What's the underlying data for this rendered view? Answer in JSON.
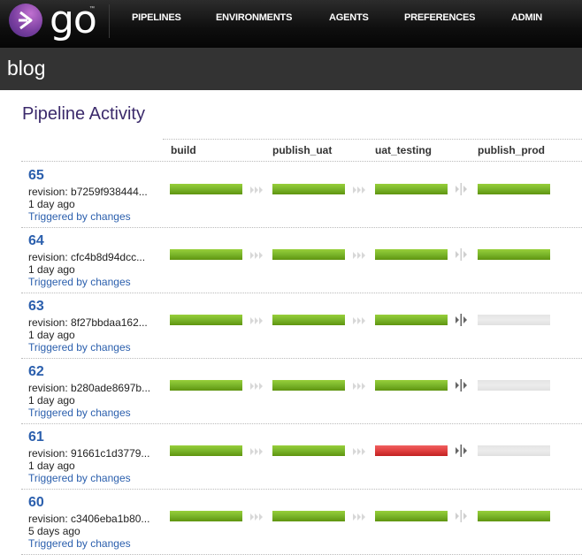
{
  "header": {
    "logo_text": "go",
    "logo_tm": "™",
    "nav": [
      {
        "label": "PIPELINES"
      },
      {
        "label": "ENVIRONMENTS"
      },
      {
        "label": "AGENTS"
      },
      {
        "label": "PREFERENCES"
      },
      {
        "label": "ADMIN"
      }
    ]
  },
  "pipeline_name": "blog",
  "page_title": "Pipeline Activity",
  "stages": [
    "build",
    "publish_uat",
    "uat_testing",
    "publish_prod"
  ],
  "transitions": [
    "auto",
    "auto",
    "manual"
  ],
  "colors": {
    "passed": "#7ab52a",
    "failed": "#e04040",
    "not_run": "#e6e6e6",
    "link": "#2b5fad",
    "title": "#3b2a6b"
  },
  "runs": [
    {
      "counter": "65",
      "revision": "revision: b7259f938444...",
      "time": "1 day ago",
      "trigger": "Triggered by changes",
      "stages": [
        "passed",
        "passed",
        "passed",
        "passed"
      ],
      "manual_gate_active": false
    },
    {
      "counter": "64",
      "revision": "revision: cfc4b8d94dcc...",
      "time": "1 day ago",
      "trigger": "Triggered by changes",
      "stages": [
        "passed",
        "passed",
        "passed",
        "passed"
      ],
      "manual_gate_active": false
    },
    {
      "counter": "63",
      "revision": "revision: 8f27bbdaa162...",
      "time": "1 day ago",
      "trigger": "Triggered by changes",
      "stages": [
        "passed",
        "passed",
        "passed",
        "unknown"
      ],
      "manual_gate_active": true
    },
    {
      "counter": "62",
      "revision": "revision: b280ade8697b...",
      "time": "1 day ago",
      "trigger": "Triggered by changes",
      "stages": [
        "passed",
        "passed",
        "passed",
        "unknown"
      ],
      "manual_gate_active": true
    },
    {
      "counter": "61",
      "revision": "revision: 91661c1d3779...",
      "time": "1 day ago",
      "trigger": "Triggered by changes",
      "stages": [
        "passed",
        "passed",
        "failed",
        "unknown"
      ],
      "manual_gate_active": true
    },
    {
      "counter": "60",
      "revision": "revision: c3406eba1b80...",
      "time": "5 days ago",
      "trigger": "Triggered by changes",
      "stages": [
        "passed",
        "passed",
        "passed",
        "passed"
      ],
      "manual_gate_active": false
    }
  ]
}
